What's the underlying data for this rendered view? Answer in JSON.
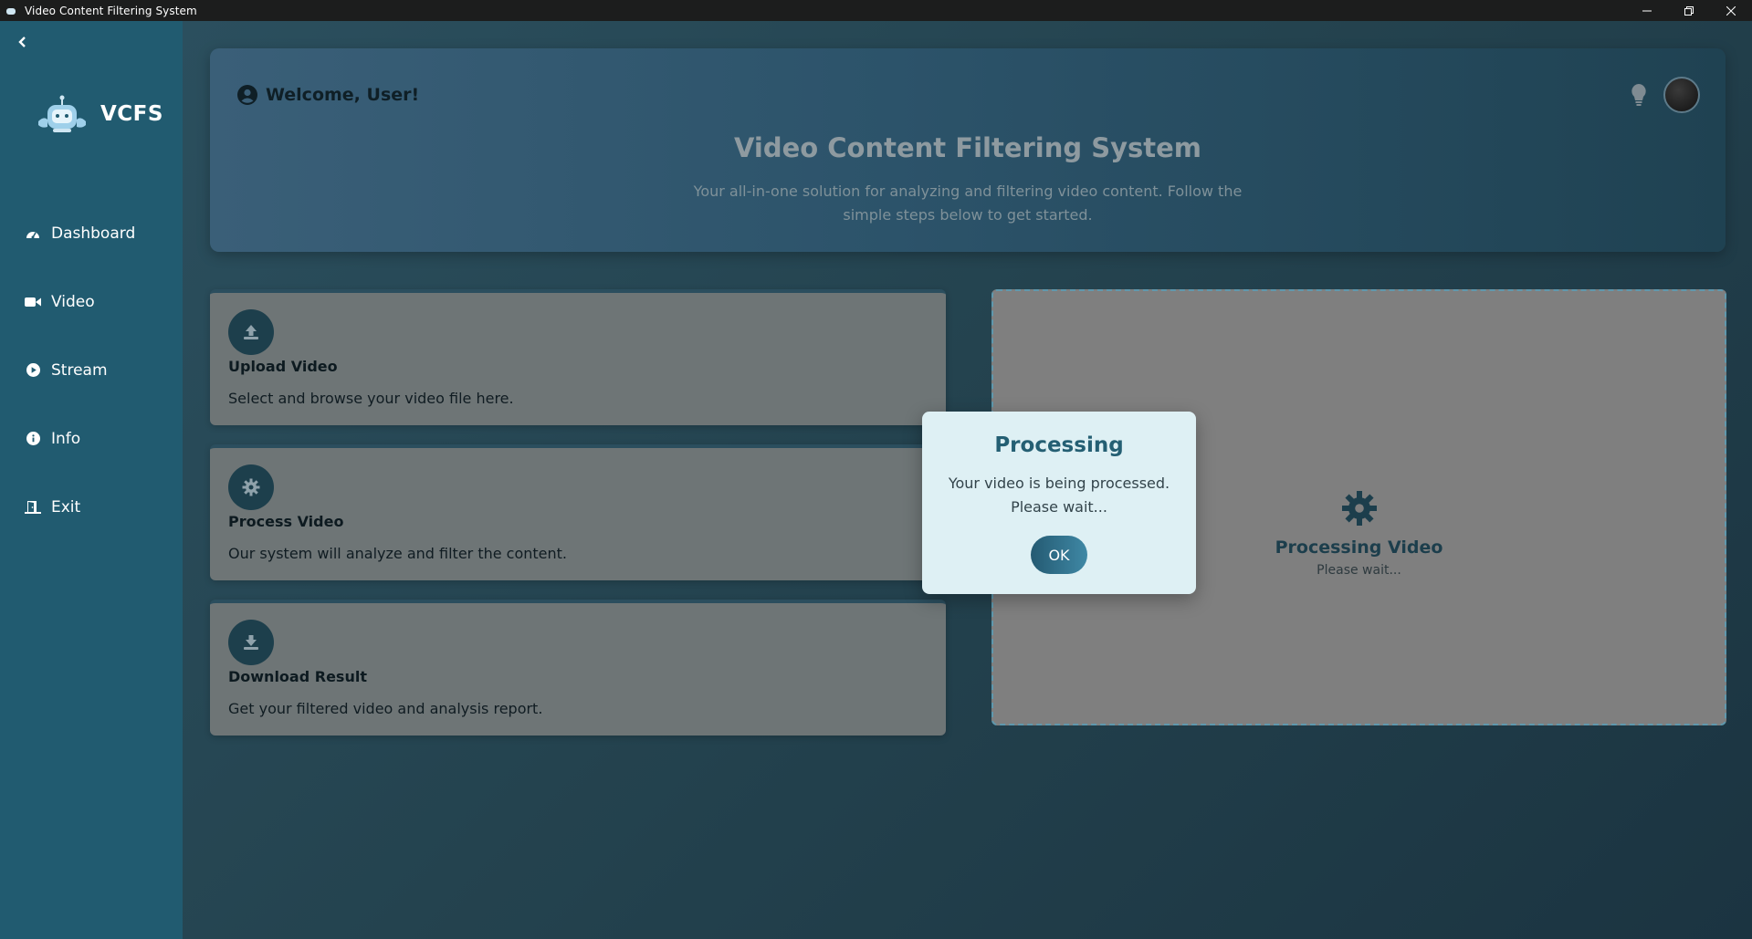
{
  "window": {
    "title": "Video Content Filtering System",
    "controls": [
      "minimize",
      "restore",
      "close"
    ]
  },
  "sidebar": {
    "logo_text": "VCFS",
    "items": [
      {
        "label": "Dashboard",
        "icon": "dashboard-icon"
      },
      {
        "label": "Video",
        "icon": "video-camera-icon"
      },
      {
        "label": "Stream",
        "icon": "play-circle-icon"
      },
      {
        "label": "Info",
        "icon": "info-circle-icon"
      },
      {
        "label": "Exit",
        "icon": "door-exit-icon"
      }
    ]
  },
  "header": {
    "welcome": "Welcome, User!",
    "title": "Video Content Filtering System",
    "subtitle": "Your all-in-one solution for analyzing and filtering video content. Follow the simple steps below to get started."
  },
  "steps": [
    {
      "title": "Upload Video",
      "description": "Select and browse your video file here.",
      "icon": "upload-icon"
    },
    {
      "title": "Process Video",
      "description": "Our system will analyze and filter the content.",
      "icon": "gear-icon"
    },
    {
      "title": "Download Result",
      "description": "Get your filtered video and analysis report.",
      "icon": "download-icon"
    }
  ],
  "processing_panel": {
    "title": "Processing Video",
    "subtitle": "Please wait...",
    "icon": "gear-icon"
  },
  "modal": {
    "title": "Processing",
    "message_line1": "Your video is being processed.",
    "message_line2": "Please wait...",
    "ok_label": "OK"
  },
  "colors": {
    "sidebar_bg": "#215b70",
    "modal_accent": "#245f73",
    "step_card_bg": "#6e7576"
  }
}
